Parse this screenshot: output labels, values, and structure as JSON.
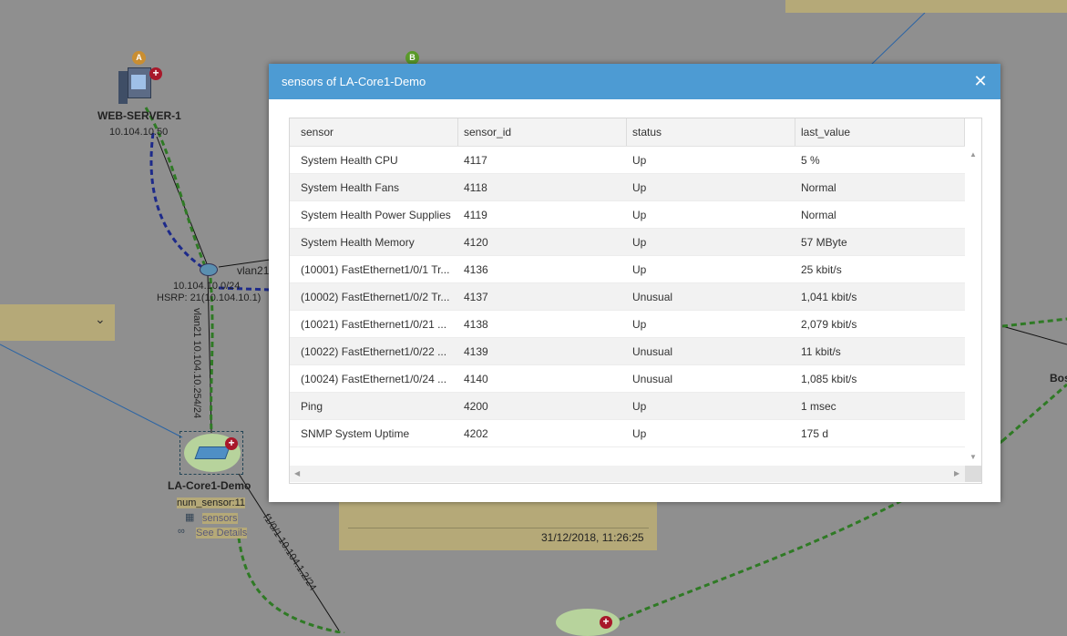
{
  "map": {
    "nodes": {
      "web_server": {
        "name": "WEB-SERVER-1",
        "ip": "10.104.10.50",
        "badge": "A"
      },
      "badge_b": "B",
      "vlan_label": "vlan21",
      "subnet": {
        "ip": "10.104.10.0/24",
        "hsrp": "HSRP: 21(10.104.10.1)"
      },
      "vertical_link": "vlan21 10.104.10.254/24",
      "core": {
        "name": "LA-Core1-Demo",
        "num_sensor": "num_sensor:11",
        "sensors_link": "sensors",
        "details_link": "See Details"
      },
      "diag_link": "f1/0/1 10.104.1.2/24",
      "right_label": "Bos",
      "timestamp": "31/12/2018, 11:26:25"
    },
    "colors": {
      "dashed_green": "#2f7a25",
      "dashed_blue": "#1d2a8a",
      "line_blue": "#2a64a5"
    }
  },
  "modal": {
    "title": "sensors of LA-Core1-Demo",
    "close_icon": "close-icon",
    "columns": [
      "sensor",
      "sensor_id",
      "status",
      "last_value"
    ],
    "rows": [
      [
        "System Health CPU",
        "4117",
        "Up",
        "5 %"
      ],
      [
        "System Health Fans",
        "4118",
        "Up",
        "Normal"
      ],
      [
        "System Health Power Supplies",
        "4119",
        "Up",
        "Normal"
      ],
      [
        "System Health Memory",
        "4120",
        "Up",
        "57 MByte"
      ],
      [
        "(10001) FastEthernet1/0/1 Tr...",
        "4136",
        "Up",
        "25 kbit/s"
      ],
      [
        "(10002) FastEthernet1/0/2 Tr...",
        "4137",
        "Unusual",
        "1,041 kbit/s"
      ],
      [
        "(10021) FastEthernet1/0/21 ...",
        "4138",
        "Up",
        "2,079 kbit/s"
      ],
      [
        "(10022) FastEthernet1/0/22 ...",
        "4139",
        "Unusual",
        "11 kbit/s"
      ],
      [
        "(10024) FastEthernet1/0/24 ...",
        "4140",
        "Unusual",
        "1,085 kbit/s"
      ],
      [
        "Ping",
        "4200",
        "Up",
        "1 msec"
      ],
      [
        "SNMP System Uptime",
        "4202",
        "Up",
        "175 d"
      ]
    ],
    "header_color": "#4d9bd3"
  }
}
